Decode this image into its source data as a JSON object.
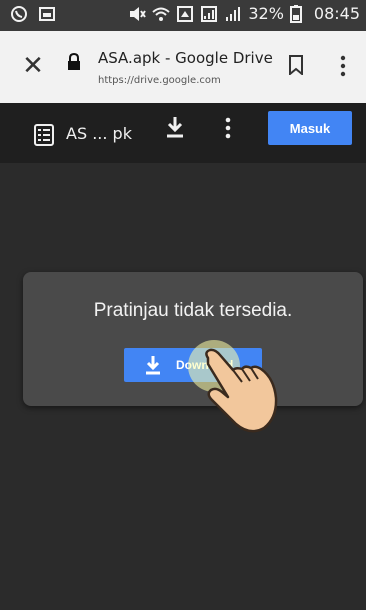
{
  "status_bar": {
    "battery": "32%",
    "time": "08:45"
  },
  "tab_bar": {
    "title": "ASA.apk - Google Drive",
    "url": "https://drive.google.com"
  },
  "drive_bar": {
    "file_name": "AS ... pk",
    "sign_in_label": "Masuk"
  },
  "viewer": {
    "message": "Pratinjau tidak tersedia.",
    "download_label": "Download"
  },
  "colors": {
    "accent": "#4285f4",
    "dark_bg": "#2b2b2b",
    "card_bg": "#4a4a4a"
  }
}
